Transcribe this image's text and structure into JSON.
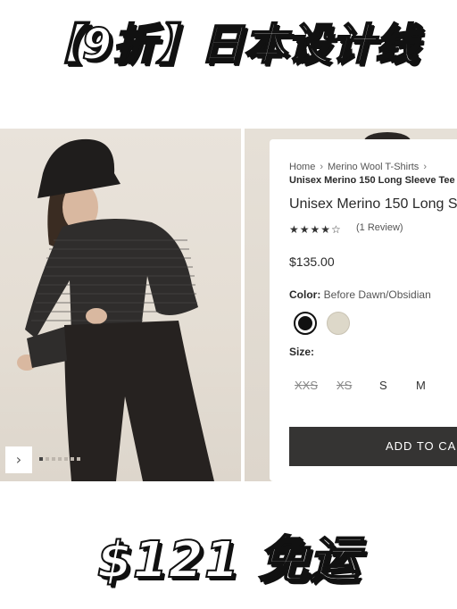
{
  "banner": {
    "top_text": "【9折】日本设计线",
    "bottom_text": "$121 免运"
  },
  "gallery": {
    "prev_arrow": "›",
    "dot_count": 7,
    "active_dot": 0
  },
  "product": {
    "breadcrumb": [
      "Home",
      "Merino Wool T-Shirts"
    ],
    "breadcrumb_separator": "›",
    "breadcrumb_current": "Unisex Merino 150 Long Sleeve Tee",
    "title": "Unisex Merino 150 Long S",
    "rating_stars": "★★★★☆",
    "rating": 4,
    "review_text": "(1 Review)",
    "price": "$135.00",
    "color_label": "Color:",
    "color_value": "Before Dawn/Obsidian",
    "swatches": [
      {
        "name": "Before Dawn/Obsidian",
        "color": "#111111",
        "selected": true
      },
      {
        "name": "light",
        "color": "#ddd8c9",
        "selected": false
      }
    ],
    "size_label": "Size:",
    "sizes": [
      {
        "label": "XXS",
        "available": false
      },
      {
        "label": "XS",
        "available": false
      },
      {
        "label": "S",
        "available": true
      },
      {
        "label": "M",
        "available": true
      }
    ],
    "add_to_cart": "ADD TO CA"
  },
  "colors": {
    "button_bg": "#353433",
    "text": "#2e2e2e",
    "photo_bg": "#e6e0d7"
  }
}
